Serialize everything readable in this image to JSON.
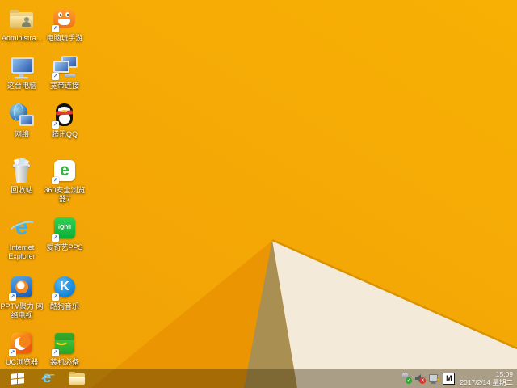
{
  "wallpaper": {
    "colors": {
      "base_top": "#F8B004",
      "base_bottom": "#F1A206",
      "fold_dark": "#EC9503",
      "khaki": "#A98F52",
      "cream": "#F4EADA",
      "ridge": "#D99200"
    }
  },
  "desktop": {
    "icons": [
      {
        "id": "administrator",
        "label": "Administra...",
        "shortcut": false
      },
      {
        "id": "pc-mobile-games",
        "label": "电脑玩手游",
        "shortcut": true
      },
      {
        "id": "this-pc",
        "label": "这台电脑",
        "shortcut": false
      },
      {
        "id": "broadband-connection",
        "label": "宽带连接",
        "shortcut": true
      },
      {
        "id": "network",
        "label": "网络",
        "shortcut": false
      },
      {
        "id": "tencent-qq",
        "label": "腾讯QQ",
        "shortcut": true
      },
      {
        "id": "recycle-bin",
        "label": "回收站",
        "shortcut": false
      },
      {
        "id": "360-safe-browser",
        "label": "360安全浏览器7",
        "shortcut": true
      },
      {
        "id": "internet-explorer",
        "label": "Internet Explorer",
        "shortcut": false
      },
      {
        "id": "iqiyi-pps",
        "label": "爱奇艺PPS",
        "shortcut": true
      },
      {
        "id": "pptv",
        "label": "PPTV聚力 网络电视",
        "shortcut": true
      },
      {
        "id": "kugou-music",
        "label": "酷狗音乐",
        "shortcut": true
      },
      {
        "id": "uc-browser",
        "label": "UC浏览器",
        "shortcut": true
      },
      {
        "id": "software-essentials",
        "label": "装机必备",
        "shortcut": true
      }
    ],
    "icon_text": {
      "se360": "e",
      "ie": "e",
      "iqiyi": "iQIYI",
      "kugou": "K",
      "shortcut_arrow": "↗"
    }
  },
  "taskbar": {
    "start_icon": "windows-logo",
    "buttons": [
      {
        "id": "internet-explorer",
        "icon_text": "e"
      },
      {
        "id": "file-explorer"
      }
    ],
    "tray": {
      "icons": [
        "usb-safely-remove",
        "volume-muted",
        "network-no-connection",
        "ime-indicator"
      ],
      "ime_letter": "M",
      "clock": {
        "time": "15:09",
        "date": "2017/2/14 星期二"
      }
    }
  }
}
